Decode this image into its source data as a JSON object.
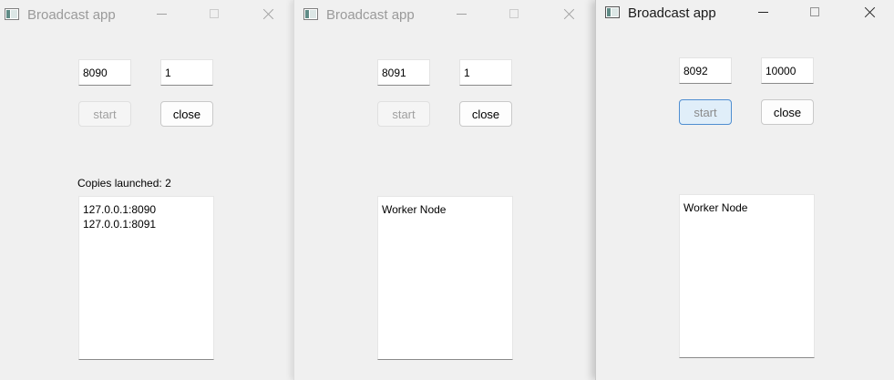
{
  "windows": [
    {
      "title": "Broadcast app",
      "port": "8090",
      "count": "1",
      "start_label": "start",
      "close_label": "close",
      "copies_label": "Copies launched: 2",
      "output": [
        "127.0.0.1:8090",
        "127.0.0.1:8091"
      ]
    },
    {
      "title": "Broadcast app",
      "port": "8091",
      "count": "1",
      "start_label": "start",
      "close_label": "close",
      "output": [
        "Worker Node"
      ]
    },
    {
      "title": "Broadcast app",
      "port": "8092",
      "count": "10000",
      "start_label": "start",
      "close_label": "close",
      "output": [
        "Worker Node"
      ]
    }
  ],
  "icons": {
    "app": "app-window-icon",
    "minimize": "minimize-icon",
    "maximize": "maximize-icon",
    "close": "close-icon"
  },
  "colors": {
    "window_bg": "#f0f0f0",
    "inactive_title": "#9a9a9a",
    "active_title": "#1a1a1a",
    "focus_border": "#4f8ed1",
    "focus_fill": "#e0eef9"
  }
}
